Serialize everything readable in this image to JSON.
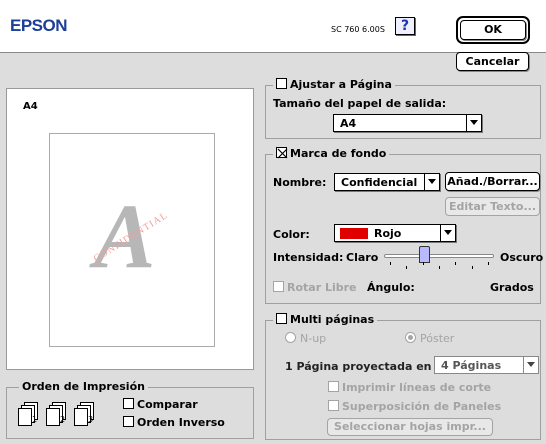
{
  "header": {
    "brand": "EPSON",
    "model": "SC 760 6.00S",
    "help_label": "?",
    "ok_label": "OK",
    "cancel_label": "Cancelar"
  },
  "preview": {
    "paper_name": "A4",
    "watermark_letter": "A",
    "watermark_text": "CONFIDENTIAL"
  },
  "order": {
    "title": "Orden de Impresión",
    "page_icons": [
      "1",
      "2",
      "3"
    ],
    "collate_label": "Comparar",
    "collate_checked": false,
    "reverse_label": "Orden Inverso",
    "reverse_checked": false
  },
  "fit_page": {
    "title": "Ajustar a Página",
    "checked": false,
    "output_size_label": "Tamaño del papel de salida:",
    "output_size_value": "A4"
  },
  "watermark": {
    "title": "Marca de fondo",
    "checked": true,
    "name_label": "Nombre:",
    "name_value": "Confidencial",
    "add_remove_label": "Añad./Borrar...",
    "edit_text_label": "Editar Texto...",
    "color_label": "Color:",
    "color_value": "Rojo",
    "color_swatch": "#e00000",
    "intensity_label": "Intensidad:",
    "light_label": "Claro",
    "dark_label": "Oscuro",
    "intensity_level": 0.35,
    "rotate_label": "Rotar Libre",
    "rotate_checked": false,
    "angle_label": "Ángulo:",
    "degrees_label": "Grados"
  },
  "multipage": {
    "title": "Multi páginas",
    "checked": false,
    "nup_label": "N-up",
    "poster_label": "Póster",
    "poster_selected": true,
    "pages_label": "1 Página proyectada en",
    "pages_value": "4 Páginas",
    "cut_lines_label": "Imprimir líneas de corte",
    "overlap_label": "Superposición de Paneles",
    "select_sheets_label": "Seleccionar hojas impr..."
  }
}
